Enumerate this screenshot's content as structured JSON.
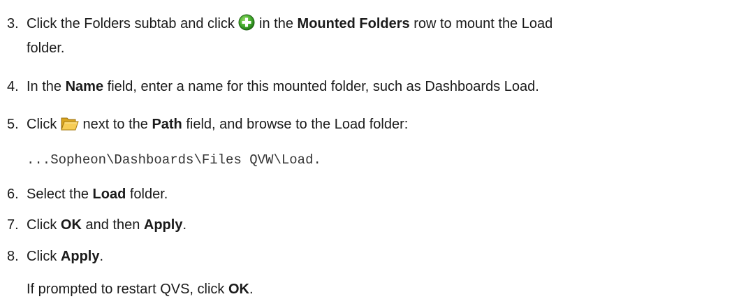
{
  "steps": [
    {
      "number": "3.",
      "t1": "Click the Folders subtab and click",
      "icon": "add-green-circle-icon",
      "t2": "in the",
      "b1": "Mounted Folders",
      "t3": "row to mount the Load",
      "t4": "folder."
    },
    {
      "number": "4.",
      "t1": "In the",
      "b1": "Name",
      "t2": "field, enter a name for this mounted folder, such as Dashboards Load."
    },
    {
      "number": "5.",
      "t1": "Click",
      "icon": "folder-open-icon",
      "t2": "next to the",
      "b1": "Path",
      "t3": "field, and browse to the Load folder:",
      "code": "...Sopheon\\Dashboards\\Files QVW\\Load."
    },
    {
      "number": "6.",
      "t1": "Select the",
      "b1": "Load",
      "t2": "folder."
    },
    {
      "number": "7.",
      "t1": "Click",
      "b1": "OK",
      "t2": "and then",
      "b2": "Apply",
      "t3": "."
    },
    {
      "number": "8.",
      "t1": "Click",
      "b1": "Apply",
      "t2": ".",
      "note_t1": "If prompted to restart QVS, click",
      "note_b1": "OK",
      "note_t2": "."
    }
  ]
}
